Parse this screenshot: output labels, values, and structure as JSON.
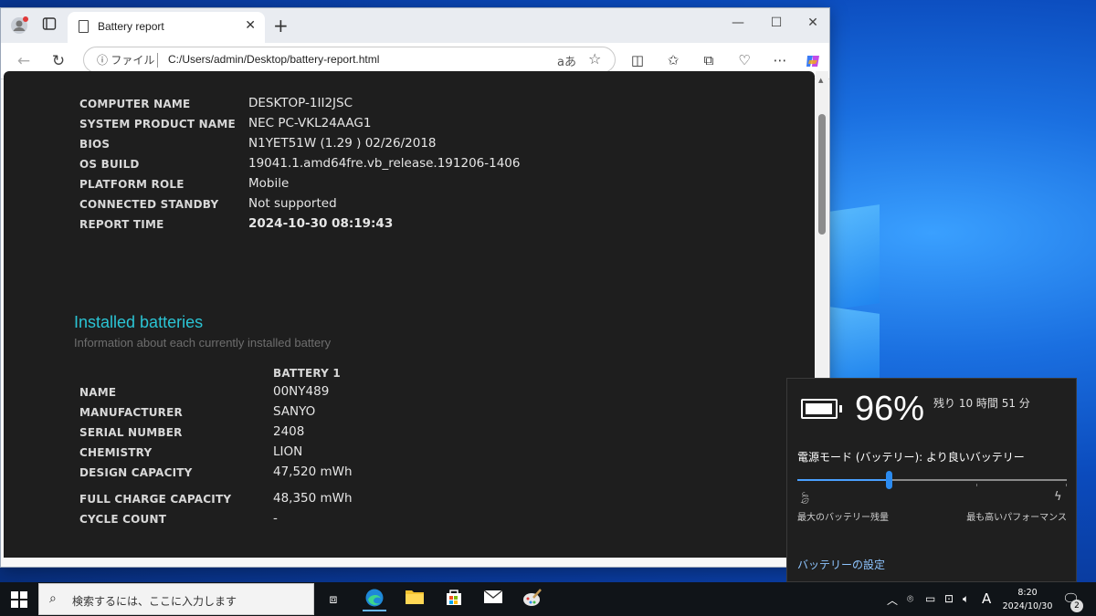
{
  "browser": {
    "tab_title": "Battery report",
    "url_info": "ファイル",
    "url": "C:/Users/admin/Desktop/battery-report.html"
  },
  "report": {
    "system": [
      {
        "key": "COMPUTER NAME",
        "value": "DESKTOP-1II2JSC"
      },
      {
        "key": "SYSTEM PRODUCT NAME",
        "value": "NEC PC-VKL24AAG1"
      },
      {
        "key": "BIOS",
        "value": "N1YET51W (1.29 ) 02/26/2018"
      },
      {
        "key": "OS BUILD",
        "value": "19041.1.amd64fre.vb_release.191206-1406"
      },
      {
        "key": "PLATFORM ROLE",
        "value": "Mobile"
      },
      {
        "key": "CONNECTED STANDBY",
        "value": "Not supported"
      },
      {
        "key": "REPORT TIME",
        "value": "2024-10-30  08:19:43"
      }
    ],
    "installed_heading": "Installed batteries",
    "installed_sub": "Information about each currently installed battery",
    "battery_col": "BATTERY 1",
    "battery": [
      {
        "key": "NAME",
        "value": "00NY489"
      },
      {
        "key": "MANUFACTURER",
        "value": "SANYO"
      },
      {
        "key": "SERIAL NUMBER",
        "value": "2408"
      },
      {
        "key": "CHEMISTRY",
        "value": "LION"
      },
      {
        "key": "DESIGN CAPACITY",
        "value": "47,520 mWh"
      },
      {
        "key": "FULL CHARGE CAPACITY",
        "value": "48,350 mWh"
      },
      {
        "key": "CYCLE COUNT",
        "value": "-"
      }
    ]
  },
  "flyout": {
    "percent": "96%",
    "percent_level": 0.96,
    "remaining": "残り 10 時間 51 分",
    "mode": "電源モード (バッテリー): より良いバッテリー",
    "slider_level": 0.34,
    "label_left": "最大のバッテリー残量",
    "label_right": "最も高いパフォーマンス",
    "settings_link": "バッテリーの設定"
  },
  "taskbar": {
    "search_placeholder": "検索するには、ここに入力します",
    "ime": "A",
    "time": "8:20",
    "date": "2024/10/30",
    "notifications": "2"
  }
}
